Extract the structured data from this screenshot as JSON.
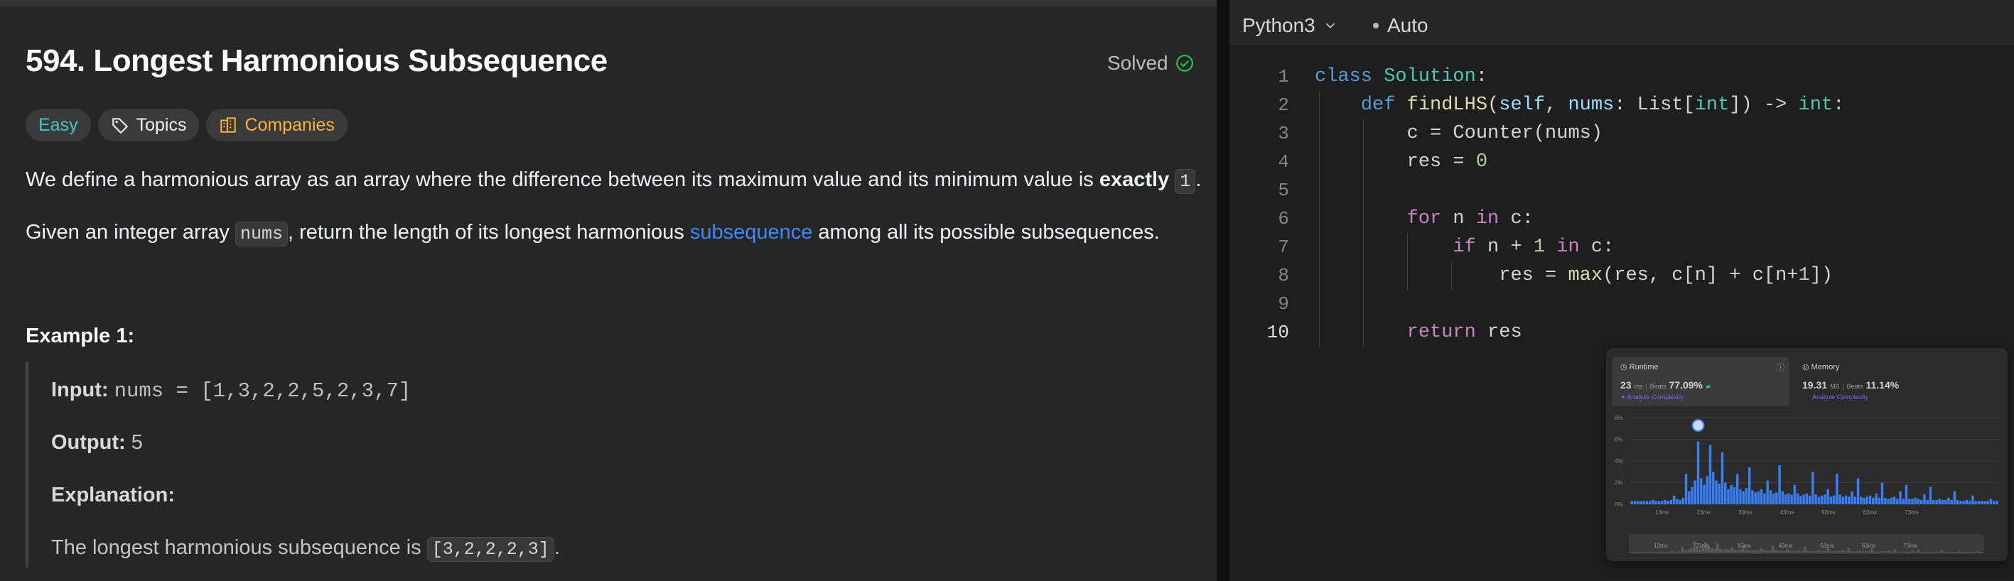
{
  "problem": {
    "title": "594. Longest Harmonious Subsequence",
    "status": "Solved",
    "tags": [
      "Easy",
      "Topics",
      "Companies"
    ],
    "p1_a": "We define a harmonious array as an array where the difference between its maximum value and its minimum value is ",
    "p1_bold": "exactly",
    "p1_code": "1",
    "p1_end": ".",
    "p2_a": "Given an integer array ",
    "p2_code": "nums",
    "p2_b": ", return the length of its longest harmonious ",
    "p2_link": "subsequence",
    "p2_c": " among all its possible subsequences.",
    "example_title": "Example 1:",
    "input_label": "Input:",
    "input_value": "nums = [1,3,2,2,5,2,3,7]",
    "output_label": "Output:",
    "output_value": "5",
    "explanation_label": "Explanation:",
    "explanation_a": "The longest harmonious subsequence is ",
    "explanation_code": "[3,2,2,2,3]",
    "explanation_end": "."
  },
  "editor": {
    "language": "Python3",
    "mode": "Auto",
    "line_numbers": [
      "1",
      "2",
      "3",
      "4",
      "5",
      "6",
      "7",
      "8",
      "9",
      "10"
    ]
  },
  "result_card": {
    "runtime_label": "Runtime",
    "runtime_value": "23",
    "runtime_unit": "ms",
    "beats_label": "Beats",
    "runtime_beats": "77.09%",
    "analyze": "Analyze Complexity",
    "memory_label": "Memory",
    "memory_value": "19.31",
    "memory_unit": "MB",
    "memory_beats": "11.14%",
    "y_ticks": [
      "8%",
      "6%",
      "4%",
      "2%",
      "0%"
    ],
    "x_ticks": [
      "13ms",
      "23ms",
      "33ms",
      "43ms",
      "53ms",
      "63ms",
      "73ms"
    ]
  },
  "chart_data": {
    "type": "bar",
    "ylim": [
      0,
      8
    ],
    "values": [
      0.3,
      0.3,
      0.3,
      0.3,
      0.3,
      0.3,
      0.3,
      0.4,
      0.3,
      0.3,
      0.3,
      0.4,
      0.3,
      0.4,
      0.8,
      0.5,
      0.4,
      0.6,
      2.8,
      1.2,
      1.6,
      2.2,
      5.8,
      2.4,
      1.8,
      2.6,
      5.5,
      3.0,
      2.2,
      1.9,
      4.8,
      2.0,
      1.4,
      1.8,
      1.6,
      2.8,
      1.4,
      1.2,
      1.5,
      3.4,
      1.3,
      1.1,
      1.2,
      1.4,
      1.0,
      2.2,
      1.3,
      1.0,
      1.1,
      3.6,
      1.2,
      0.9,
      1.0,
      0.9,
      1.8,
      1.0,
      0.8,
      0.9,
      1.0,
      0.8,
      3.0,
      0.9,
      0.7,
      0.8,
      0.9,
      1.4,
      0.7,
      0.8,
      2.8,
      0.9,
      0.7,
      0.8,
      0.7,
      1.2,
      0.7,
      2.4,
      0.7,
      0.6,
      0.7,
      0.8,
      0.6,
      1.0,
      0.6,
      2.0,
      0.6,
      0.5,
      0.6,
      0.7,
      0.5,
      1.2,
      0.5,
      1.8,
      0.5,
      0.5,
      0.6,
      0.5,
      0.4,
      0.9,
      0.4,
      1.6,
      0.4,
      0.4,
      0.5,
      0.4,
      0.4,
      0.6,
      0.4,
      1.2,
      0.4,
      0.3,
      0.3,
      0.4,
      0.3,
      0.8,
      0.3,
      0.3,
      0.3,
      0.3,
      0.3,
      0.5,
      0.3,
      0.3
    ],
    "highlight_index": 22
  }
}
